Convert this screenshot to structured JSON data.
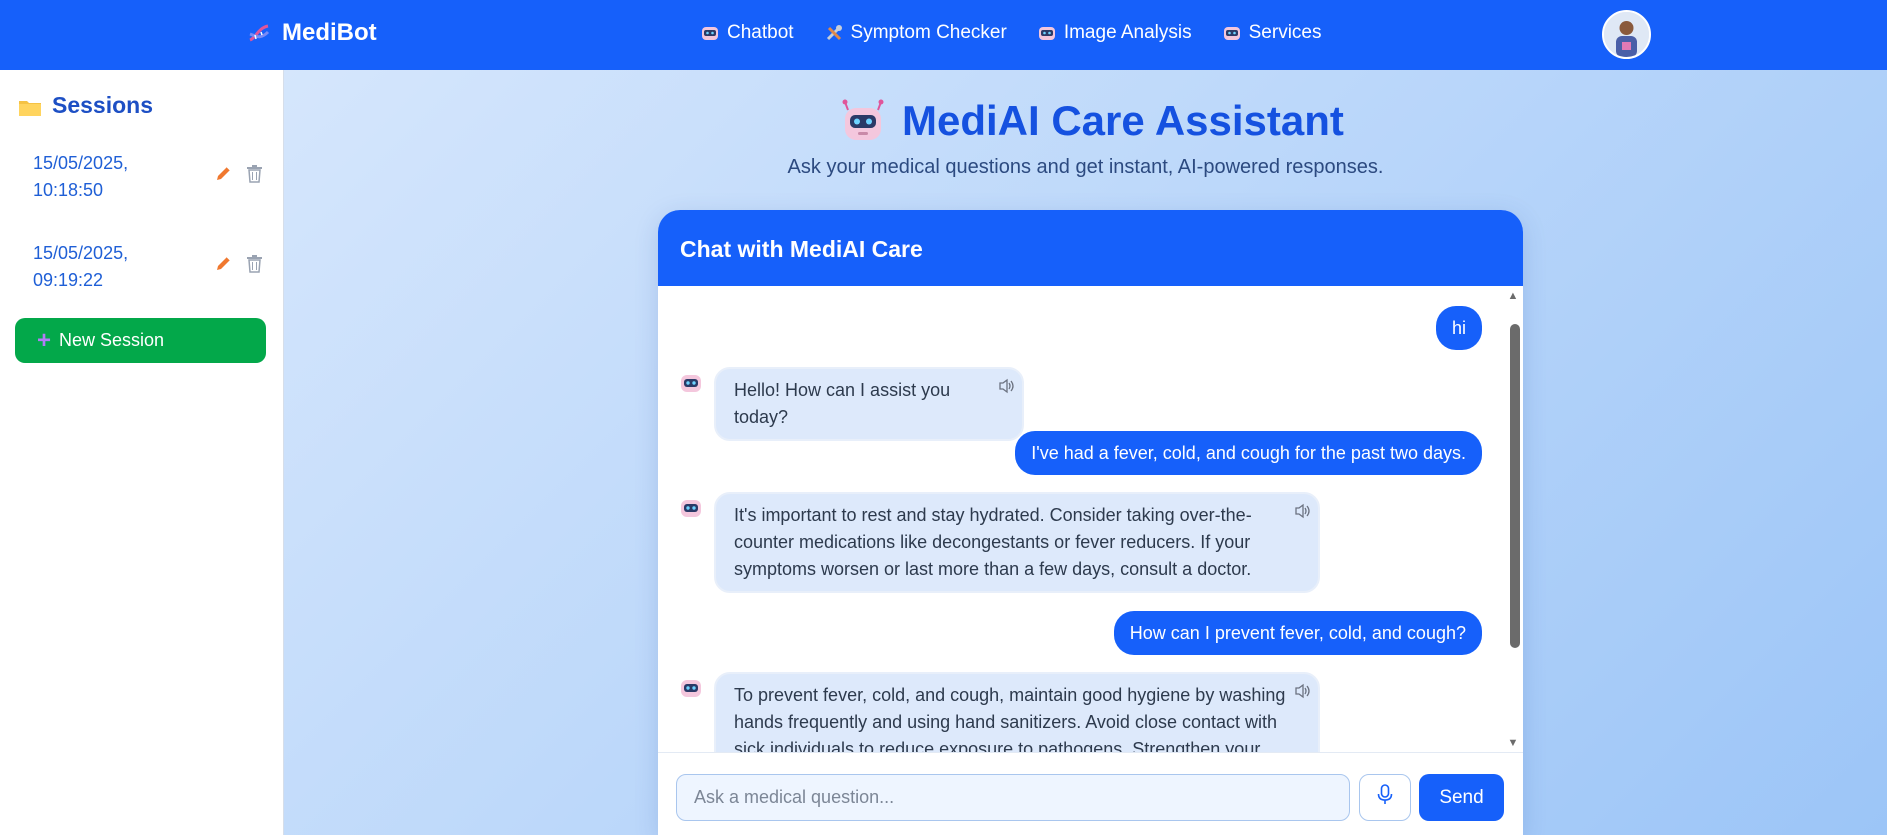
{
  "navbar": {
    "brand": "MediBot",
    "links": [
      {
        "label": "Chatbot",
        "icon": "robot-icon"
      },
      {
        "label": "Symptom Checker",
        "icon": "tools-icon"
      },
      {
        "label": "Image Analysis",
        "icon": "robot-icon"
      },
      {
        "label": "Services",
        "icon": "robot-icon"
      }
    ],
    "avatar_icon": "user-avatar"
  },
  "sidebar": {
    "title": "Sessions",
    "sessions": [
      {
        "label": "15/05/2025, 10:18:50"
      },
      {
        "label": "15/05/2025, 09:19:22"
      }
    ],
    "new_session_label": "New Session"
  },
  "main": {
    "title": "MediAI Care Assistant",
    "subtitle": "Ask your medical questions and get instant, AI-powered responses."
  },
  "chat": {
    "header": "Chat with MediAI Care",
    "messages": [
      {
        "role": "user",
        "text": "hi"
      },
      {
        "role": "bot",
        "text": "Hello! How can I assist you today?"
      },
      {
        "role": "user",
        "text": "I've had a fever, cold, and cough for the past two days."
      },
      {
        "role": "bot",
        "text": "It's important to rest and stay hydrated. Consider taking over-the-counter medications like decongestants or fever reducers. If your symptoms worsen or last more than a few days, consult a doctor."
      },
      {
        "role": "user",
        "text": "How can I prevent fever, cold, and cough?"
      },
      {
        "role": "bot",
        "text": "To prevent fever, cold, and cough, maintain good hygiene by washing hands frequently and using hand sanitizers. Avoid close contact with sick individuals to reduce exposure to pathogens. Strengthen your"
      }
    ],
    "input_placeholder": "Ask a medical question...",
    "input_value": "",
    "send_label": "Send"
  },
  "colors": {
    "primary": "#1660fa",
    "success": "#03a84a",
    "bot_bubble": "#dde9fb",
    "title": "#1551e0"
  }
}
